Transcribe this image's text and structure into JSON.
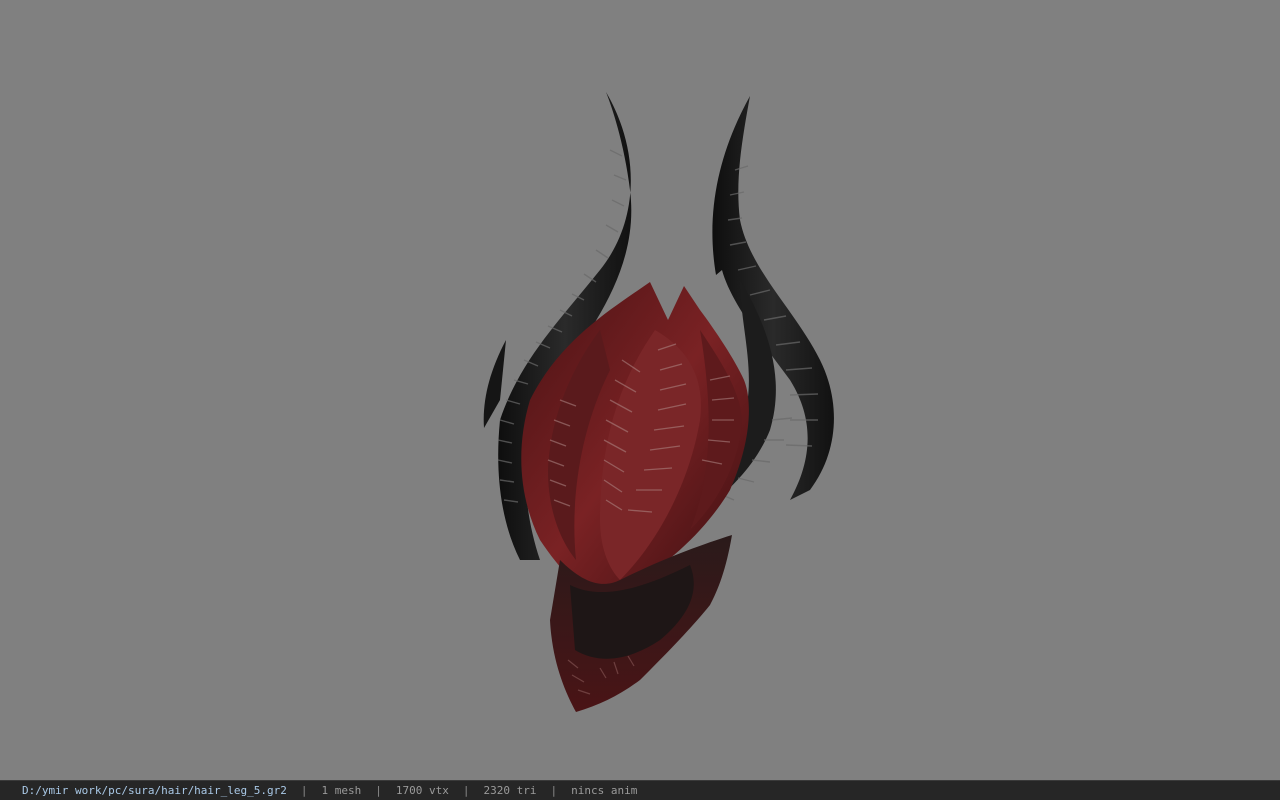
{
  "viewport": {
    "background_color": "#808080",
    "model_name": "hair_leg_5.gr2"
  },
  "statusbar": {
    "path": "D:/ymir work/pc/sura/hair/hair_leg_5.gr2",
    "separator": "|",
    "mesh": "1 mesh",
    "vtx": "1700 vtx",
    "tri": "2320 tri",
    "anim": "nincs anim"
  },
  "colors": {
    "horn": "#1a1a1a",
    "crest_red": "#6e1c1e",
    "crest_dark": "#2a1414",
    "stripe": "#8a8a8a"
  }
}
